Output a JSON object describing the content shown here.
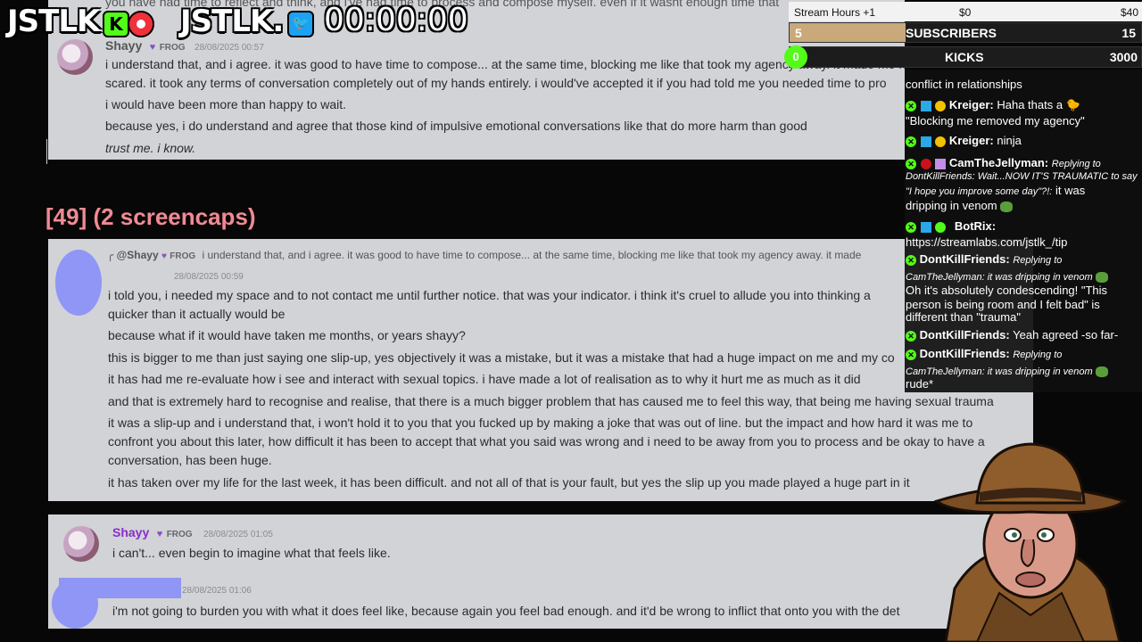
{
  "overlay": {
    "logo1": "JSTLK",
    "logo2": "JSTLK.",
    "timer": "00:00:00",
    "stream_hours": "Stream Hours +1",
    "hours_start": "$0",
    "hours_end": "$40",
    "subs_count": "5",
    "subs_label": "SUBSCRIBERS",
    "subs_goal": "15",
    "subs_progress": 0.33,
    "kicks_count": "0",
    "kicks_label": "KICKS",
    "kicks_goal": "3000",
    "kicks_progress": 0.0
  },
  "panel1": {
    "top_text": "you have had time to reflect and think, and i've had time to process and compose myself. even if it wasnt enough time that",
    "username": "Shayy",
    "badge": "FROG",
    "timestamp": "28/08/2025 00:57",
    "lines": [
      "i understand that, and i agree. it was good to have time to compose... at the same time, blocking me like that took my agency away. it made me feel trapped and",
      "scared. it took any terms of conversation completely out of my hands entirely. i would've accepted it if you had told me you needed time to pro",
      "i would have been more than happy to wait.",
      "because yes, i do understand and agree that those kind of impulsive emotional conversations like that do more harm than good",
      "trust me. i know."
    ]
  },
  "heading": "[49] (2 screencaps)",
  "panel2": {
    "reply_user": "@Shayy",
    "reply_badge": "FROG",
    "reply_text": "i understand that, and i agree. it was good to have time to compose... at the same time, blocking me like that took my agency away. it made",
    "timestamp": "28/08/2025 00:59",
    "lines": [
      "i told you, i needed my space and to not contact me until further notice. that was your indicator. i think it's cruel to allude you into thinking a",
      "quicker than it actually would be",
      "because what if it would have taken me months, or years shayy?",
      "this is bigger to me than just saying one slip-up, yes objectively it was a mistake, but it was a mistake that had a huge impact on me and my co",
      "it has had me re-evaluate how i see and interact with sexual topics. i have made a lot of realisation as to why it hurt me as much as it did",
      "and that is extremely hard to recognise and realise, that there is a much bigger problem that has caused me to feel this way, that being me having sexual trauma",
      "it was a slip-up and i understand that, i won't hold it to you that you fucked up by making a joke that was out of line. but the impact and how hard it was me to",
      "confront you about this later, how difficult it has been to accept that what you said was wrong and i need to be away from you to process and be okay to have a",
      "conversation, has been huge.",
      "it has taken over my life for the last week, it has been difficult. and not all of that is your fault, but yes the slip up you made played a huge part in it"
    ]
  },
  "panel3": {
    "username": "Shayy",
    "badge": "FROG",
    "timestamp": "28/08/2025 01:05",
    "line1": "i can't... even begin to imagine what that feels like.",
    "timestamp2": "28/08/2025 01:06",
    "line2": "i'm not going to burden you with what it does feel like, because again you feel bad enough. and it'd be wrong to inflict that onto you with the det"
  },
  "chat": {
    "m0": "conflict in relationships",
    "m1_user": "Kreiger:",
    "m1_text": "Haha thats a",
    "m1_text2": "\"Blocking me removed my agency\"",
    "m2_user": "Kreiger:",
    "m2_text": "ninja",
    "m3_user": "CamTheJellyman:",
    "m3_reply": "Replying to",
    "m3_quote1": "DontKillFriends: Wait...NOW IT'S TRAUMATIC to say",
    "m3_quote2": "\"I hope you improve some day\"?!:",
    "m3_text1": "it was",
    "m3_text2": "dripping in venom",
    "m4_user": "BotRix:",
    "m4_text": "https://streamlabs.com/jstlk_/tip",
    "m5_user": "DontKillFriends:",
    "m5_reply": "Replying to",
    "m5_quote": "CamTheJellyman: it was dripping in venom",
    "m5_text1": "Oh it's absolutely condescending! \"This",
    "m5_text2": "person is being room and I felt bad\" is",
    "m5_text3": "different than \"trauma\"",
    "m6_user": "DontKillFriends:",
    "m6_text": "Yeah agreed -so far-",
    "m7_user": "DontKillFriends:",
    "m7_reply": "Replying to",
    "m7_quote": "CamTheJellyman: it was dripping in venom",
    "m7_text": "rude*"
  },
  "colors": {
    "kick_green": "#53fc18",
    "heading_pink": "#f08a93",
    "redact_blue": "#8f96f5",
    "subs_fill": "#c9a87a"
  }
}
